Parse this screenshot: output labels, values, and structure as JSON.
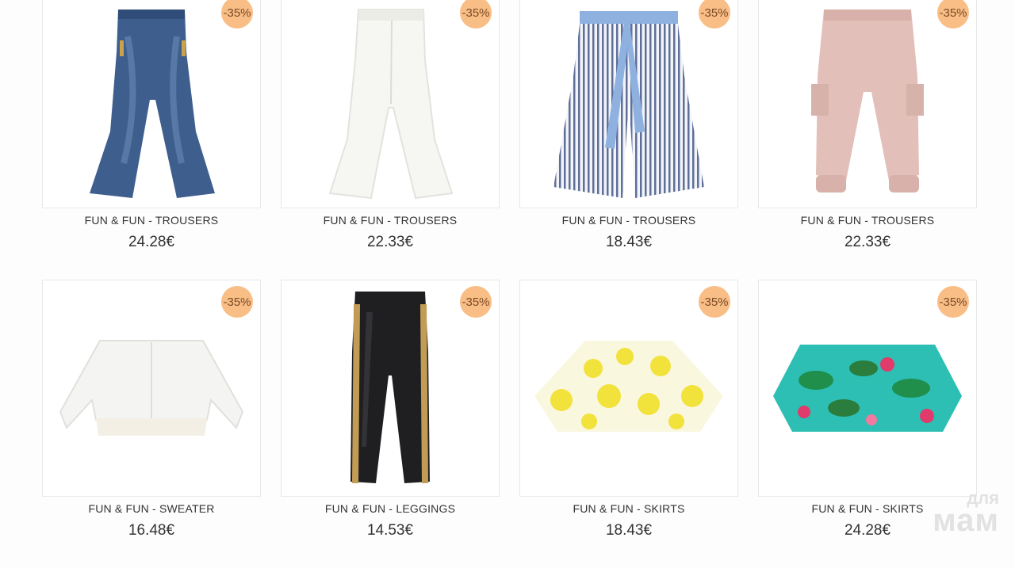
{
  "products": [
    {
      "name": "FUN & FUN - TROUSERS",
      "price": "24.28€",
      "discount": "-35%",
      "image": "jeans-flared-illustration"
    },
    {
      "name": "FUN & FUN - TROUSERS",
      "price": "22.33€",
      "discount": "-35%",
      "image": "white-flared-trousers-illustration"
    },
    {
      "name": "FUN & FUN - TROUSERS",
      "price": "18.43€",
      "discount": "-35%",
      "image": "striped-culottes-illustration"
    },
    {
      "name": "FUN & FUN - TROUSERS",
      "price": "22.33€",
      "discount": "-35%",
      "image": "pink-cargo-joggers-illustration"
    },
    {
      "name": "FUN & FUN - SWEATER",
      "price": "16.48€",
      "discount": "-35%",
      "image": "white-cropped-cardigan-illustration"
    },
    {
      "name": "FUN & FUN - LEGGINGS",
      "price": "14.53€",
      "discount": "-35%",
      "image": "black-gold-leggings-illustration"
    },
    {
      "name": "FUN & FUN - SKIRTS",
      "price": "18.43€",
      "discount": "-35%",
      "image": "yellow-polka-skirt-illustration"
    },
    {
      "name": "FUN & FUN - SKIRTS",
      "price": "24.28€",
      "discount": "-35%",
      "image": "tropical-print-skirt-illustration"
    }
  ],
  "colors": {
    "badge": "#f9bd86",
    "text": "#333333",
    "border": "#e8e8e8"
  },
  "watermark": {
    "line1": "для",
    "line2": "мам"
  }
}
